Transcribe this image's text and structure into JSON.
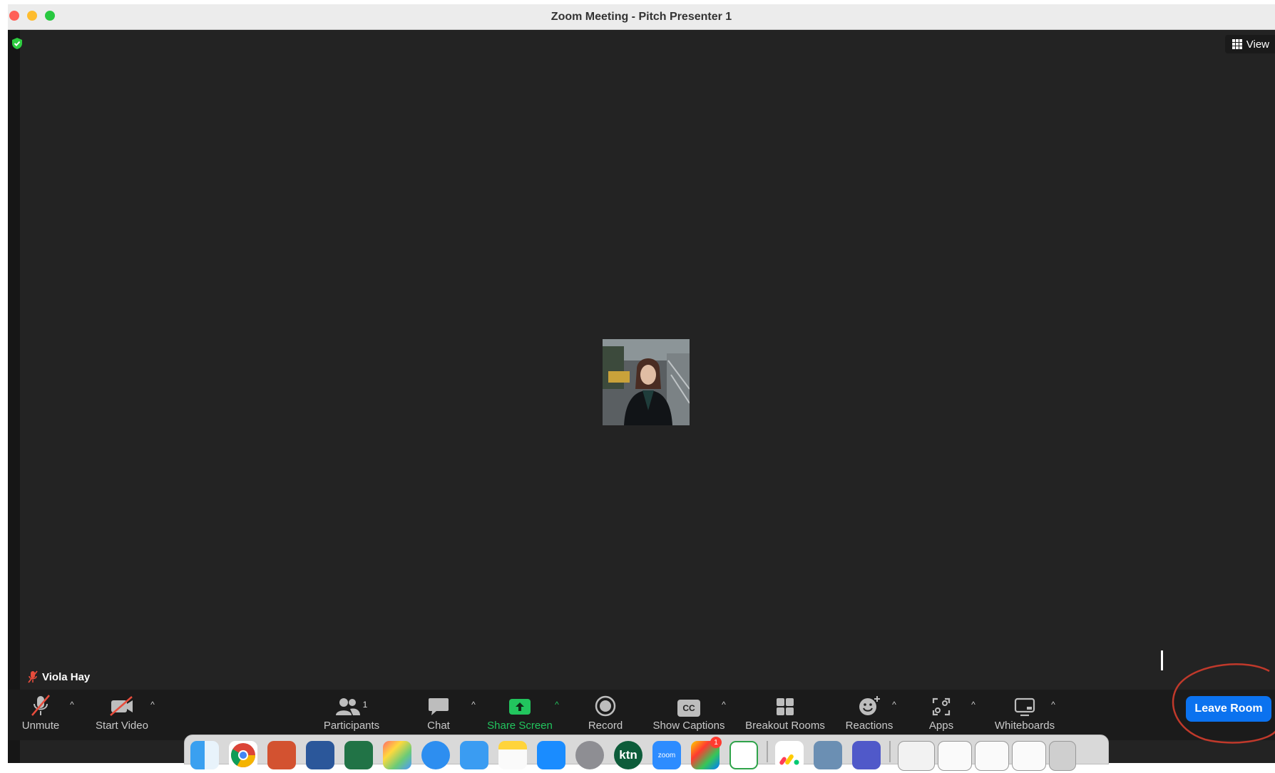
{
  "window": {
    "title": "Zoom Meeting - Pitch Presenter 1",
    "view_label": "View"
  },
  "participant": {
    "name": "Viola Hay"
  },
  "toolbar": {
    "unmute": "Unmute",
    "start_video": "Start Video",
    "participants": "Participants",
    "participants_count": "1",
    "chat": "Chat",
    "share_screen": "Share Screen",
    "record": "Record",
    "show_captions": "Show Captions",
    "captions_icon_text": "CC",
    "breakout_rooms": "Breakout Rooms",
    "reactions": "Reactions",
    "apps": "Apps",
    "whiteboards": "Whiteboards",
    "leave_room": "Leave Room"
  },
  "dock": {
    "apps": [
      "finder-icon",
      "chrome-icon",
      "powerpoint-icon",
      "word-icon",
      "excel-icon",
      "launchpad-icon",
      "safari-icon",
      "mail-icon",
      "notes-icon",
      "appstore-icon",
      "system-settings-icon",
      "ktn-icon",
      "zoom-icon",
      "photos-icon",
      "citrix-icon",
      "monday-icon",
      "preview-icon",
      "teams-icon"
    ],
    "ktn_label": "ktn",
    "zoom_label": "zoom",
    "photos_badge": "1"
  },
  "colors": {
    "meeting_bg": "#232323",
    "toolbar_bg": "#1b1b1b",
    "share_green": "#22c55e",
    "leave_blue": "#0b72ef",
    "annotation_red": "#c0392b"
  }
}
